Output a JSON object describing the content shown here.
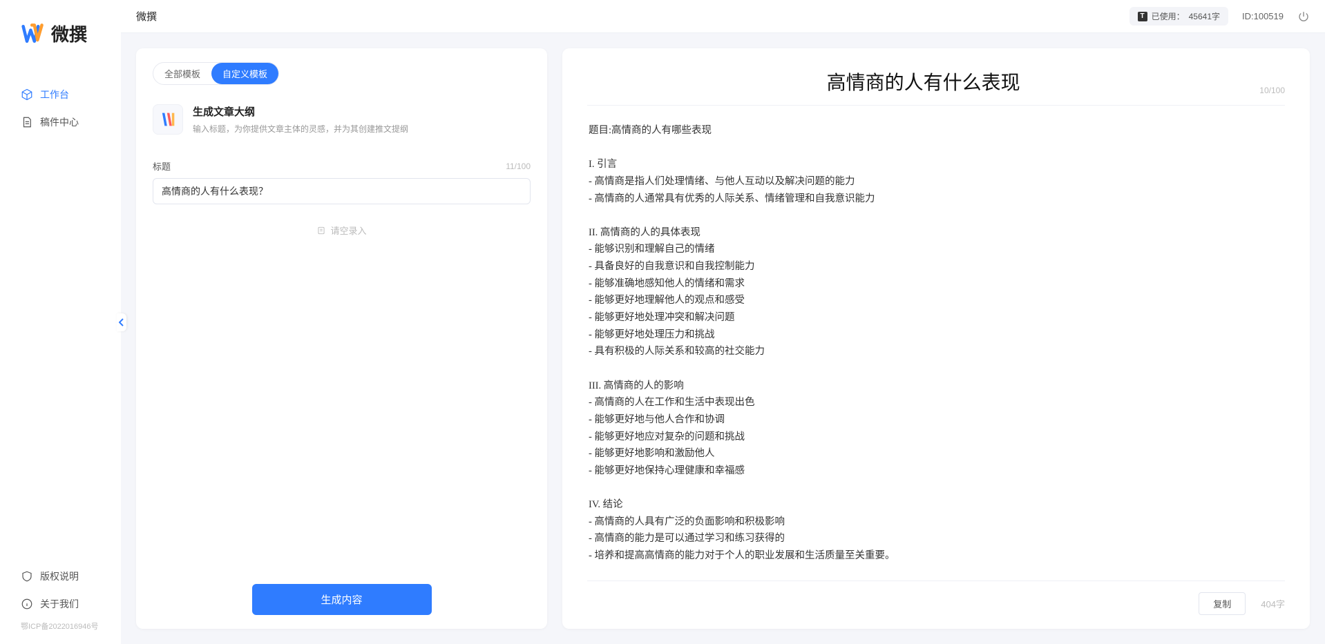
{
  "brand": {
    "name": "微撰"
  },
  "sidebar": {
    "nav": [
      {
        "label": "工作台",
        "icon": "cube"
      },
      {
        "label": "稿件中心",
        "icon": "document"
      }
    ],
    "bottom": [
      {
        "label": "版权说明",
        "icon": "shield"
      },
      {
        "label": "关于我们",
        "icon": "info"
      }
    ],
    "icp": "鄂ICP备2022016946号"
  },
  "topbar": {
    "title": "微撰",
    "usage_prefix": "已使用：",
    "usage_value": "45641字",
    "user_id_label": "ID:100519"
  },
  "tabs": {
    "all": "全部模板",
    "custom": "自定义模板",
    "active_index": 1
  },
  "template": {
    "name": "生成文章大纲",
    "desc": "输入标题，为你提供文章主体的灵感，并为其创建推文提纲"
  },
  "form": {
    "title_label": "标题",
    "title_value": "高情商的人有什么表现？",
    "title_count": "11/100",
    "empty_tip": "请空录入"
  },
  "generate_label": "生成内容",
  "result": {
    "title": "高情商的人有什么表现",
    "title_count": "10/100",
    "body": "题目:高情商的人有哪些表现\n\nI. 引言\n- 高情商是指人们处理情绪、与他人互动以及解决问题的能力\n- 高情商的人通常具有优秀的人际关系、情绪管理和自我意识能力\n\nII. 高情商的人的具体表现\n- 能够识别和理解自己的情绪\n- 具备良好的自我意识和自我控制能力\n- 能够准确地感知他人的情绪和需求\n- 能够更好地理解他人的观点和感受\n- 能够更好地处理冲突和解决问题\n- 能够更好地处理压力和挑战\n- 具有积极的人际关系和较高的社交能力\n\nIII. 高情商的人的影响\n- 高情商的人在工作和生活中表现出色\n- 能够更好地与他人合作和协调\n- 能够更好地应对复杂的问题和挑战\n- 能够更好地影响和激励他人\n- 能够更好地保持心理健康和幸福感\n\nIV. 结论\n- 高情商的人具有广泛的负面影响和积极影响\n- 高情商的能力是可以通过学习和练习获得的\n- 培养和提高高情商的能力对于个人的职业发展和生活质量至关重要。",
    "copy_label": "复制",
    "word_count": "404字"
  }
}
